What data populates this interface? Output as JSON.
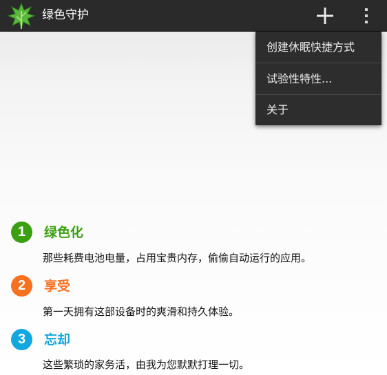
{
  "app": {
    "title": "绿色守护",
    "icon": "leaf-icon",
    "add_icon": "plus-icon",
    "overflow_icon": "more-vert-icon"
  },
  "menu": {
    "items": [
      {
        "label": "创建休眠快捷方式"
      },
      {
        "label": "试验性特性..."
      },
      {
        "label": "关于"
      }
    ]
  },
  "features": [
    {
      "number": "1",
      "title": "绿色化",
      "description": "那些耗费电池电量，占用宝贵内存，偷偷自动运行的应用。",
      "color": "#3aa010"
    },
    {
      "number": "2",
      "title": "享受",
      "description": "第一天拥有这部设备时的爽滑和持久体验。",
      "color": "#f7701e"
    },
    {
      "number": "3",
      "title": "忘却",
      "description": "这些繁琐的家务活，由我为您默默打理一切。",
      "color": "#12a7df"
    }
  ],
  "colors": {
    "actionbar": "#2a2a2a",
    "menu": "#2d2d2d"
  }
}
